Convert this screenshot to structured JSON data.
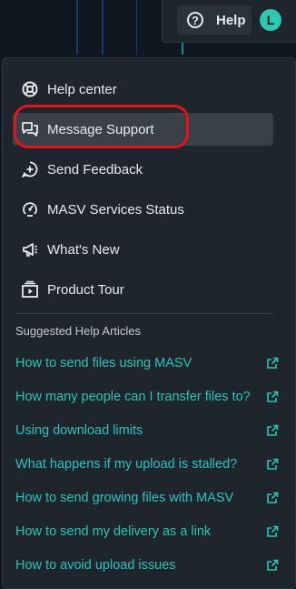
{
  "topbar": {
    "help_label": "Help",
    "avatar_initial": "L"
  },
  "menu": {
    "items": [
      {
        "label": "Help center",
        "icon": "lifebuoy-icon"
      },
      {
        "label": "Message Support",
        "icon": "chat-icon",
        "active": true
      },
      {
        "label": "Send Feedback",
        "icon": "feedback-icon"
      },
      {
        "label": "MASV Services Status",
        "icon": "status-icon"
      },
      {
        "label": "What's New",
        "icon": "megaphone-icon"
      },
      {
        "label": "Product Tour",
        "icon": "tour-icon"
      }
    ]
  },
  "articles": {
    "title": "Suggested Help Articles",
    "items": [
      "How to send files using MASV",
      "How many people can I transfer files to?",
      "Using download limits",
      "What happens if my upload is stalled?",
      "How to send growing files with MASV",
      "How to send my delivery as a link",
      "How to avoid upload issues"
    ]
  },
  "colors": {
    "accent": "#2fc3b7",
    "highlight": "#e0141f",
    "panel": "#1f252c"
  }
}
